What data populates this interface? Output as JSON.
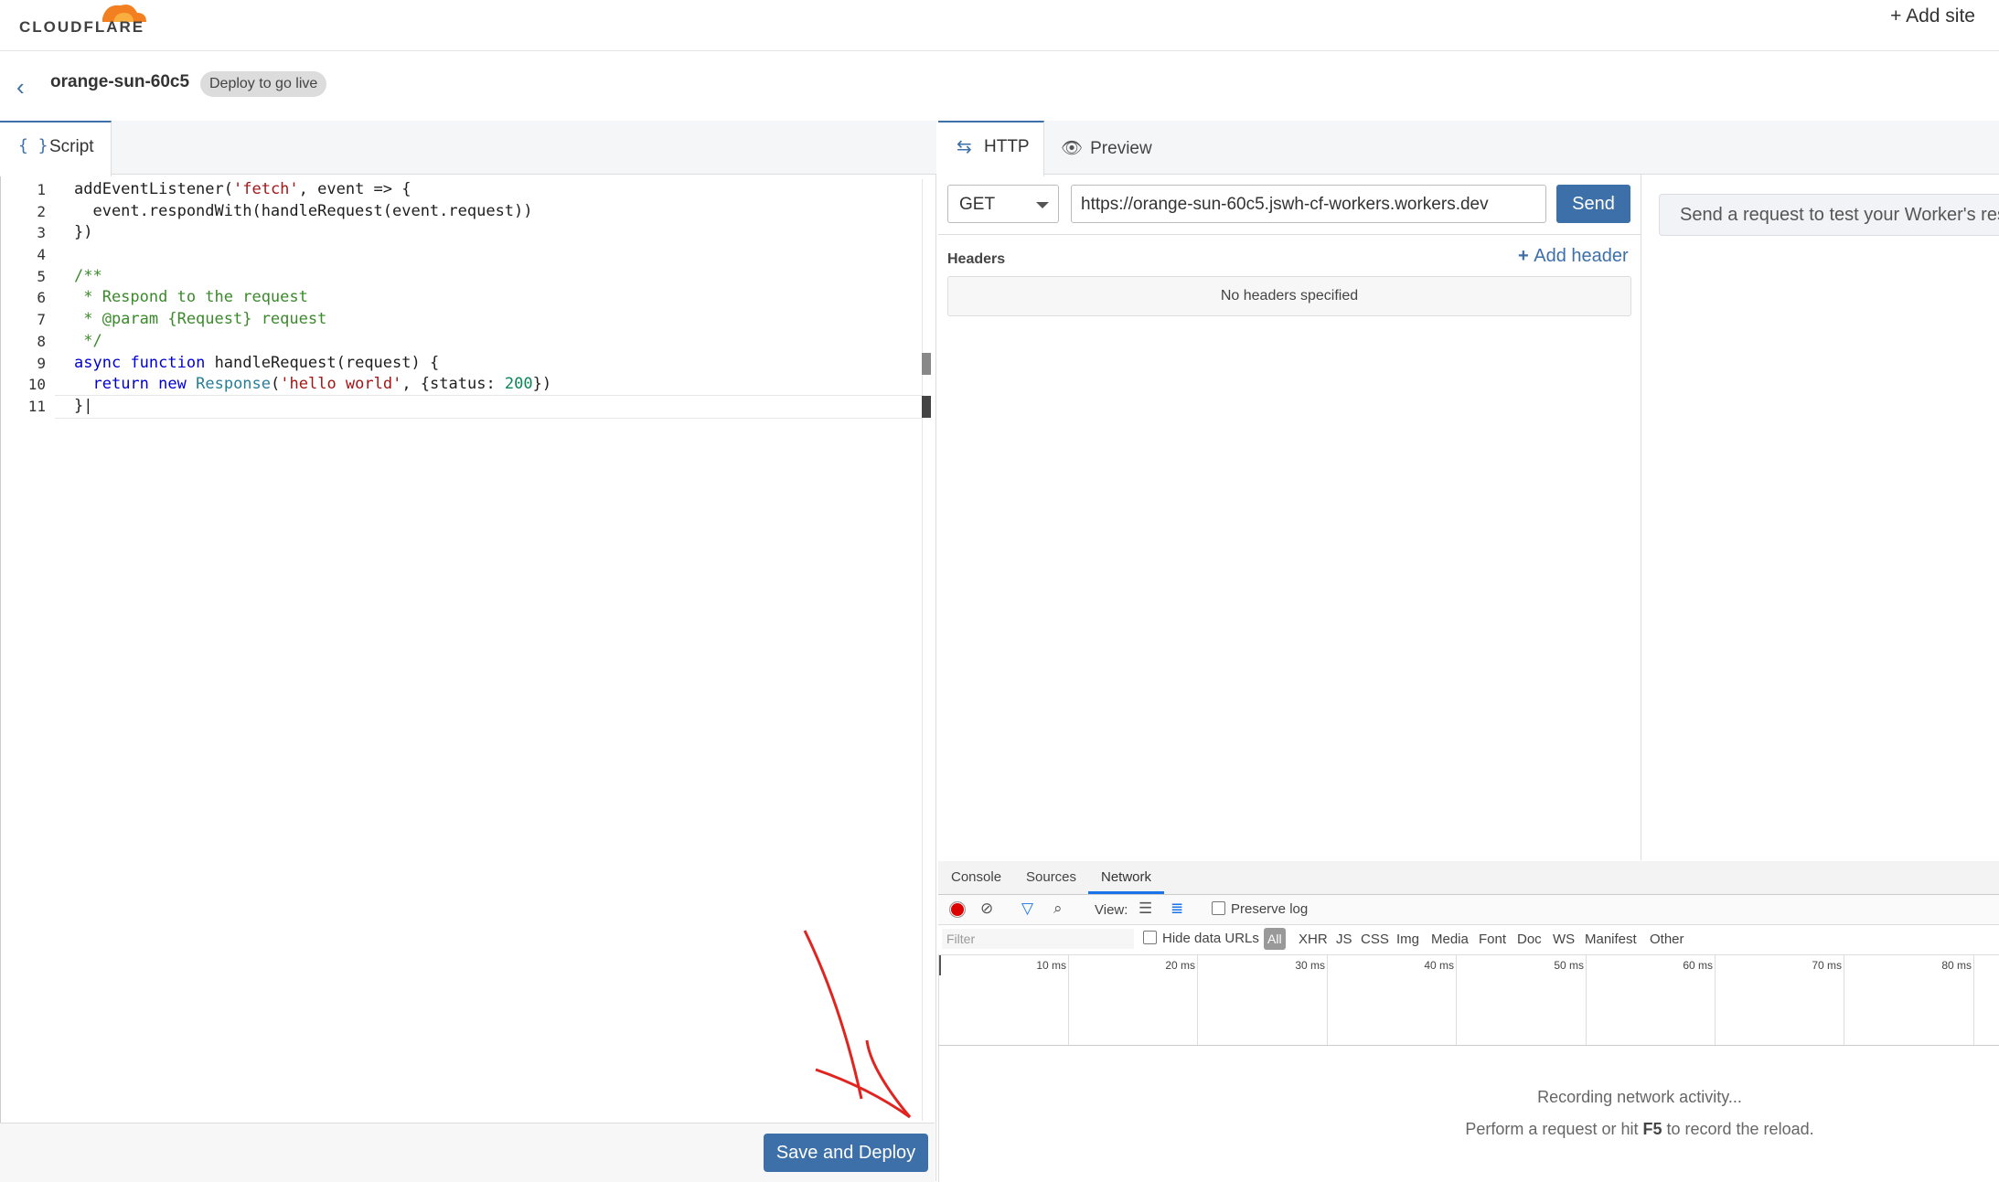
{
  "header": {
    "logo_text": "CLOUDFLARE",
    "add_site": "+ Add site"
  },
  "worker": {
    "name": "orange-sun-60c5",
    "badge": "Deploy to go live"
  },
  "editor": {
    "tab_label": "Script",
    "line_numbers": [
      "1",
      "2",
      "3",
      "4",
      "5",
      "6",
      "7",
      "8",
      "9",
      "10",
      "11"
    ],
    "deploy_label": "Save and Deploy"
  },
  "request": {
    "tabs": {
      "http": "HTTP",
      "preview": "Preview"
    },
    "method": "GET",
    "url": "https://orange-sun-60c5.jswh-cf-workers.workers.dev",
    "send_label": "Send",
    "headers_label": "Headers",
    "add_header_label": "Add header",
    "no_headers": "No headers specified",
    "response_placeholder": "Send a request to test your Worker's response"
  },
  "devtools": {
    "tabs": [
      "Console",
      "Sources",
      "Network"
    ],
    "active_tab": "Network",
    "view_label": "View:",
    "preserve_log": "Preserve log",
    "filter_placeholder": "Filter",
    "hide_data_urls": "Hide data URLs",
    "filter_types": [
      "All",
      "XHR",
      "JS",
      "CSS",
      "Img",
      "Media",
      "Font",
      "Doc",
      "WS",
      "Manifest",
      "Other"
    ],
    "timeline_ticks": [
      "10 ms",
      "20 ms",
      "30 ms",
      "40 ms",
      "50 ms",
      "60 ms",
      "70 ms",
      "80 ms"
    ],
    "recording_msg": "Recording network activity...",
    "reload_msg_prefix": "Perform a request or hit ",
    "reload_msg_key": "F5",
    "reload_msg_suffix": " to record the reload."
  },
  "colors": {
    "accent": "#3d6fa8",
    "record": "#dd0000",
    "cloudflare_orange": "#f38020",
    "annotation_red": "#e0241f"
  }
}
